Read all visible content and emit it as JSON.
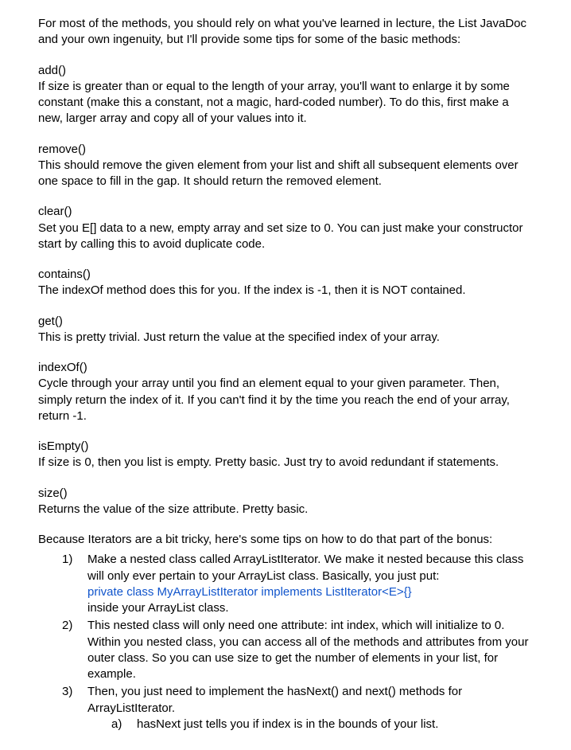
{
  "intro": "For most of the methods, you should rely on what you've learned in lecture, the List JavaDoc and your own ingenuity, but I'll provide some tips for some of the basic methods:",
  "methods": {
    "add": {
      "name": "add()",
      "desc": "If size is greater than or equal to the length of your array, you'll want to enlarge it by some constant (make this a constant, not a magic, hard-coded number).  To do this, first make a new, larger array and copy all of your values into it."
    },
    "remove": {
      "name": "remove()",
      "desc": "This should remove the given element from your list and shift all subsequent elements over one space to fill in the gap.  It should return the removed element."
    },
    "clear": {
      "name": "clear()",
      "desc": "Set you E[] data to a new, empty array and set size to 0.  You can just make your constructor start by calling this to avoid duplicate code."
    },
    "contains": {
      "name": "contains()",
      "desc": "The indexOf method does this for you.  If the index is -1, then it is NOT contained."
    },
    "get": {
      "name": "get()",
      "desc": "This is pretty trivial.  Just return the value at the specified index of your array."
    },
    "indexOf": {
      "name": "indexOf()",
      "desc": "Cycle through your array until you find an element equal to your given parameter.  Then, simply return the index of it.  If you can't find it by the time you reach the end of your array, return -1."
    },
    "isEmpty": {
      "name": "isEmpty()",
      "desc": "If size is 0, then you list is empty.  Pretty basic.  Just try to avoid redundant if statements."
    },
    "size": {
      "name": "size()",
      "desc": "Returns the value of the size attribute.  Pretty basic."
    }
  },
  "iterator": {
    "intro": "Because Iterators are a bit tricky, here's some tips on how to do that part of the bonus:",
    "items": [
      {
        "num": "1)",
        "text_before": "Make a nested class called ArrayListIterator.  We make it nested because this class will only ever pertain to your ArrayList class.  Basically, you just put:",
        "code": "private class MyArrayListIterator implements ListIterator<E>{}",
        "text_after": "inside your ArrayList class."
      },
      {
        "num": "2)",
        "text": "This nested class will only need one attribute: int index, which will initialize to 0.  Within you nested class, you can access all of the methods and attributes from your outer class.  So you can use size to get the number of elements in your list, for example."
      },
      {
        "num": "3)",
        "text": "Then, you just need to implement the hasNext() and next() methods for ArrayListIterator.",
        "sub": [
          {
            "num": "a)",
            "text": "hasNext just tells you if index is in the bounds of your list."
          }
        ]
      }
    ]
  }
}
